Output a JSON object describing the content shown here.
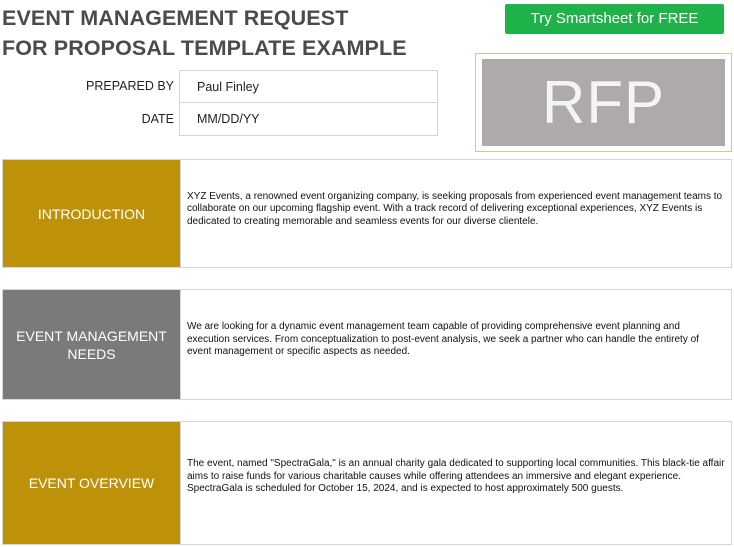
{
  "header": {
    "title_line1": "EVENT MANAGEMENT REQUEST",
    "title_line2": "FOR PROPOSAL TEMPLATE EXAMPLE",
    "cta_label": "Try Smartsheet for FREE"
  },
  "meta": {
    "prepared_by_label": "PREPARED BY",
    "prepared_by_value": "Paul Finley",
    "date_label": "DATE",
    "date_value": "MM/DD/YY"
  },
  "badge": {
    "text": "RFP"
  },
  "sections": [
    {
      "heading": "INTRODUCTION",
      "text": "XYZ Events, a renowned event organizing company, is seeking proposals from experienced event management teams to collaborate on our upcoming flagship event. With a track record of delivering exceptional experiences, XYZ Events is dedicated to creating memorable and seamless events for our diverse clientele."
    },
    {
      "heading": "EVENT MANAGEMENT NEEDS",
      "text": "We are looking for a dynamic event management team capable of providing comprehensive event planning and execution services. From conceptualization to post-event analysis, we seek a partner who can handle the entirety of event management or specific aspects as needed."
    },
    {
      "heading": "EVENT OVERVIEW",
      "text": "The event, named \"SpectraGala,\" is an annual charity gala dedicated to supporting local communities. This black-tie affair aims to raise funds for various charitable causes while offering attendees an immersive and elegant experience. SpectraGala is scheduled for October 15, 2024, and is expected to host approximately 500 guests."
    }
  ],
  "colors": {
    "gold": "#be9208",
    "grey": "#7a7a7a",
    "cta_green": "#1fb24a",
    "badge_grey": "#aeaaa9"
  }
}
